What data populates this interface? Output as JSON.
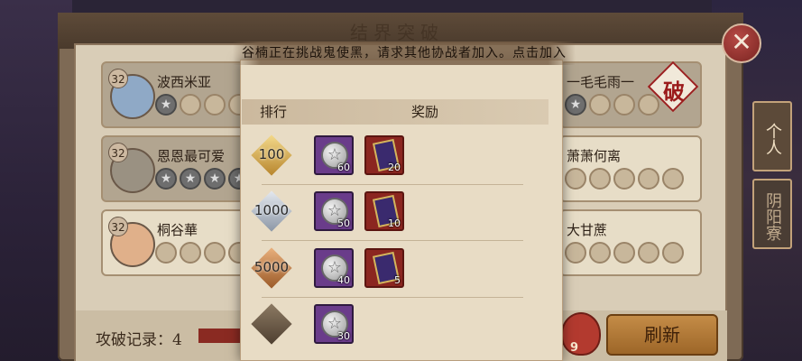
{
  "panel": {
    "title": "结界突破"
  },
  "notice": "谷楠正在挑战鬼使黑，请求其他协战者加入。点击加入",
  "popup": {
    "header_rank": "排行",
    "header_reward": "奖励",
    "rows": [
      {
        "rank": "100",
        "badge": "gold",
        "items": [
          {
            "kind": "coin",
            "qty": "60"
          },
          {
            "kind": "book",
            "qty": "20"
          }
        ]
      },
      {
        "rank": "1000",
        "badge": "silver",
        "items": [
          {
            "kind": "coin",
            "qty": "50"
          },
          {
            "kind": "book",
            "qty": "10"
          }
        ]
      },
      {
        "rank": "5000",
        "badge": "bronze",
        "items": [
          {
            "kind": "coin",
            "qty": "40"
          },
          {
            "kind": "book",
            "qty": "5"
          }
        ]
      },
      {
        "rank": "",
        "badge": "dark",
        "items": [
          {
            "kind": "coin",
            "qty": "30"
          }
        ]
      }
    ]
  },
  "entries_left": [
    {
      "name": "波西米亚",
      "level": "32"
    },
    {
      "name": "恩恩最可爱",
      "level": "32"
    },
    {
      "name": "桐谷華",
      "level": "32"
    }
  ],
  "entries_right": [
    {
      "name": "一毛毛雨一"
    },
    {
      "name": "萧萧何离"
    },
    {
      "name": "大甘蔗"
    }
  ],
  "break_mark": "破",
  "tabs": {
    "personal": "个人",
    "yinyang": "阴阳寮"
  },
  "bottom": {
    "record": "攻破记录：4",
    "refresh": "刷新",
    "daruma_count": "9"
  },
  "icons": {
    "close": "close-icon",
    "coin": "star-coin-icon",
    "book": "scroll-book-icon"
  },
  "colors": {
    "accent": "#9d6628",
    "close": "#b64a45",
    "popup_bg": "#e8dcc5"
  }
}
